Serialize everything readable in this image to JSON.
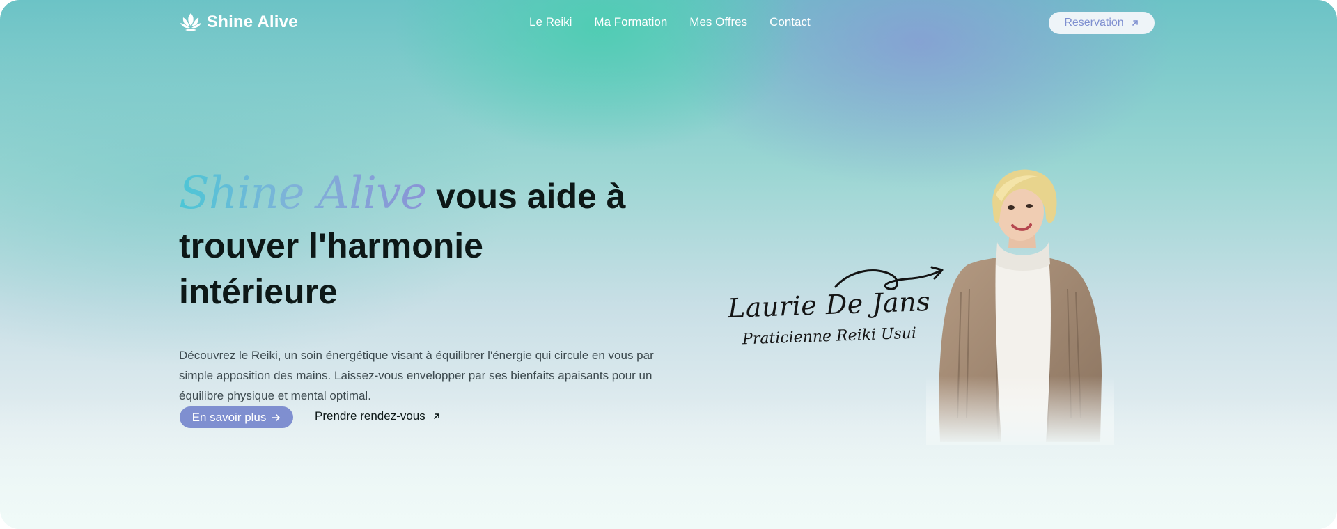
{
  "logo": {
    "text": "Shine Alive",
    "icon": "lotus-icon"
  },
  "nav": {
    "items": [
      "Le Reiki",
      "Ma Formation",
      "Mes Offres",
      "Contact"
    ]
  },
  "header_button": {
    "label": "Reservation",
    "icon": "arrow-up-right-icon"
  },
  "hero": {
    "brand_script": "Shine Alive",
    "title_line1_rest": "vous aide à",
    "title_line2": "trouver l'harmonie",
    "title_line3": "intérieure",
    "description": "Découvrez le Reiki, un soin énergétique visant à équilibrer l'énergie qui circule en vous par simple apposition des mains. Laissez-vous envelopper par ses bienfaits apaisants pour un équilibre physique et mental optimal.",
    "primary_cta": {
      "label": "En savoir plus",
      "icon": "arrow-right-icon"
    },
    "secondary_cta": {
      "label": "Prendre rendez-vous",
      "icon": "arrow-up-right-icon"
    }
  },
  "portrait": {
    "name": "Laurie De Jans",
    "role": "Praticienne Reiki Usui",
    "arrow_icon": "curved-arrow-icon"
  },
  "colors": {
    "accent": "#7f8fd0",
    "teal": "#4cc6d6",
    "text_dark": "#0d1817"
  }
}
